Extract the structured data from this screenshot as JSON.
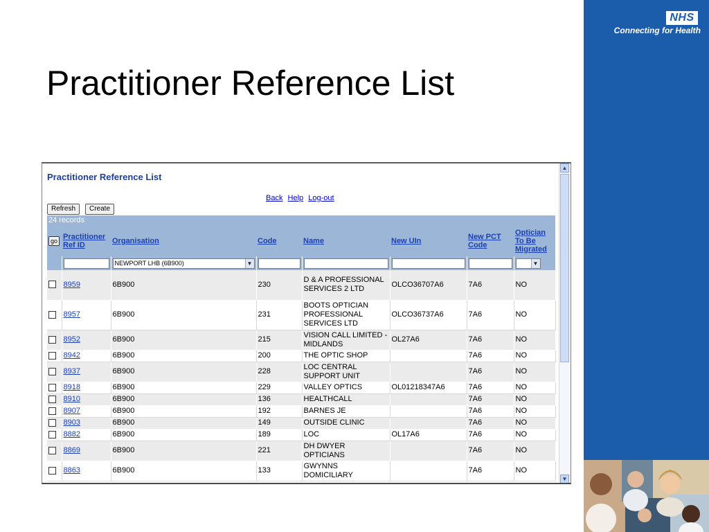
{
  "slide": {
    "title": "Practitioner Reference List"
  },
  "branding": {
    "logo_text": "NHS",
    "tagline": "Connecting for Health"
  },
  "app": {
    "title": "Practitioner Reference List",
    "links": [
      "Back",
      "Help",
      "Log-out"
    ],
    "buttons": {
      "refresh": "Refresh",
      "create": "Create"
    },
    "records_count": "24 records",
    "go_label": "go",
    "columns": {
      "ref_id": "Practitioner Ref ID",
      "organisation": "Organisation",
      "code": "Code",
      "name": "Name",
      "new_uin": "New UIn",
      "new_pct": "New PCT Code",
      "optician": "Optician To Be Migrated"
    },
    "filters": {
      "organisation": "NEWPORT LHB (6B900)",
      "optician": ""
    },
    "rows": [
      {
        "ref_id": "8959",
        "organisation": "6B900",
        "code": "230",
        "name": "D & A PROFESSIONAL SERVICES 2 LTD",
        "uin": "OLCO36707A6",
        "pct": "7A6",
        "migrate": "NO"
      },
      {
        "ref_id": "8957",
        "organisation": "6B900",
        "code": "231",
        "name": "BOOTS OPTICIAN PROFESSIONAL SERVICES LTD",
        "uin": "OLCO36737A6",
        "pct": "7A6",
        "migrate": "NO"
      },
      {
        "ref_id": "8952",
        "organisation": "6B900",
        "code": "215",
        "name": "VISION CALL LIMITED - MIDLANDS",
        "uin": "OL27A6",
        "pct": "7A6",
        "migrate": "NO"
      },
      {
        "ref_id": "8942",
        "organisation": "6B900",
        "code": "200",
        "name": "THE OPTIC SHOP",
        "uin": "",
        "pct": "7A6",
        "migrate": "NO"
      },
      {
        "ref_id": "8937",
        "organisation": "6B900",
        "code": "228",
        "name": "LOC CENTRAL SUPPORT UNIT",
        "uin": "",
        "pct": "7A6",
        "migrate": "NO"
      },
      {
        "ref_id": "8918",
        "organisation": "6B900",
        "code": "229",
        "name": "VALLEY OPTICS",
        "uin": "OL01218347A6",
        "pct": "7A6",
        "migrate": "NO"
      },
      {
        "ref_id": "8910",
        "organisation": "6B900",
        "code": "136",
        "name": "HEALTHCALL",
        "uin": "",
        "pct": "7A6",
        "migrate": "NO"
      },
      {
        "ref_id": "8907",
        "organisation": "6B900",
        "code": "192",
        "name": "BARNES JE",
        "uin": "",
        "pct": "7A6",
        "migrate": "NO"
      },
      {
        "ref_id": "8903",
        "organisation": "6B900",
        "code": "149",
        "name": "OUTSIDE CLINIC",
        "uin": "",
        "pct": "7A6",
        "migrate": "NO"
      },
      {
        "ref_id": "8882",
        "organisation": "6B900",
        "code": "189",
        "name": "LOC",
        "uin": "OL17A6",
        "pct": "7A6",
        "migrate": "NO"
      },
      {
        "ref_id": "8869",
        "organisation": "6B900",
        "code": "221",
        "name": "DH DWYER OPTICIANS",
        "uin": "",
        "pct": "7A6",
        "migrate": "NO"
      },
      {
        "ref_id": "8863",
        "organisation": "6B900",
        "code": "133",
        "name": "GWYNNS DOMICILIARY",
        "uin": "",
        "pct": "7A6",
        "migrate": "NO"
      }
    ]
  }
}
